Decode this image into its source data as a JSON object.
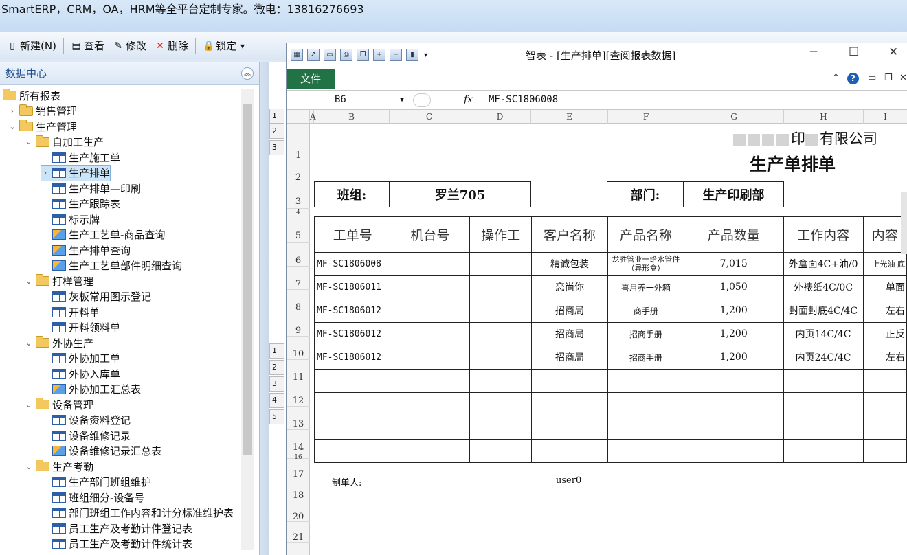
{
  "banner": {
    "text": "SmartERP，CRM，OA，HRM等全平台定制专家。微电：13816276693"
  },
  "toolbar": [
    {
      "id": "new",
      "label": "新建(N)",
      "icon": "new-doc-icon",
      "glyph": "▯"
    },
    {
      "id": "view",
      "label": "查看",
      "icon": "view-icon",
      "glyph": "▤"
    },
    {
      "id": "edit",
      "label": "修改",
      "icon": "edit-icon",
      "glyph": "✎"
    },
    {
      "id": "delete",
      "label": "删除",
      "icon": "delete-icon",
      "glyph": "✕"
    },
    {
      "id": "lock",
      "label": "锁定",
      "icon": "lock-icon",
      "glyph": "🔒"
    }
  ],
  "sidebar": {
    "title": "数据中心",
    "items": [
      {
        "label": "所有报表",
        "level": 0,
        "type": "folder",
        "arrow": ""
      },
      {
        "label": "销售管理",
        "level": 1,
        "type": "folder",
        "arrow": "›"
      },
      {
        "label": "生产管理",
        "level": 1,
        "type": "folder",
        "arrow": "⌄"
      },
      {
        "label": "自加工生产",
        "level": 2,
        "type": "folder",
        "arrow": "⌄"
      },
      {
        "label": "生产施工单",
        "level": 3,
        "type": "grid",
        "arrow": ""
      },
      {
        "label": "生产排单",
        "level": 3,
        "type": "grid",
        "arrow": "›",
        "selected": true
      },
      {
        "label": "生产排单—印刷",
        "level": 3,
        "type": "grid",
        "arrow": ""
      },
      {
        "label": "生产跟踪表",
        "level": 3,
        "type": "grid",
        "arrow": ""
      },
      {
        "label": "标示牌",
        "level": 3,
        "type": "grid",
        "arrow": ""
      },
      {
        "label": "生产工艺单-商品查询",
        "level": 3,
        "type": "chart",
        "arrow": ""
      },
      {
        "label": "生产排单查询",
        "level": 3,
        "type": "chart",
        "arrow": ""
      },
      {
        "label": "生产工艺单部件明细查询",
        "level": 3,
        "type": "chart",
        "arrow": ""
      },
      {
        "label": "打样管理",
        "level": 2,
        "type": "folder",
        "arrow": "⌄"
      },
      {
        "label": "灰板常用图示登记",
        "level": 3,
        "type": "grid",
        "arrow": ""
      },
      {
        "label": "开料单",
        "level": 3,
        "type": "grid",
        "arrow": ""
      },
      {
        "label": "开料领料单",
        "level": 3,
        "type": "grid",
        "arrow": ""
      },
      {
        "label": "外协生产",
        "level": 2,
        "type": "folder",
        "arrow": "⌄"
      },
      {
        "label": "外协加工单",
        "level": 3,
        "type": "grid",
        "arrow": ""
      },
      {
        "label": "外协入库单",
        "level": 3,
        "type": "grid",
        "arrow": ""
      },
      {
        "label": "外协加工汇总表",
        "level": 3,
        "type": "chart",
        "arrow": ""
      },
      {
        "label": "设备管理",
        "level": 2,
        "type": "folder",
        "arrow": "⌄"
      },
      {
        "label": "设备资料登记",
        "level": 3,
        "type": "grid",
        "arrow": ""
      },
      {
        "label": "设备维修记录",
        "level": 3,
        "type": "grid",
        "arrow": ""
      },
      {
        "label": "设备维修记录汇总表",
        "level": 3,
        "type": "chart",
        "arrow": ""
      },
      {
        "label": "生产考勤",
        "level": 2,
        "type": "folder",
        "arrow": "⌄"
      },
      {
        "label": "生产部门班组维护",
        "level": 3,
        "type": "grid",
        "arrow": ""
      },
      {
        "label": "班组细分-设备号",
        "level": 3,
        "type": "grid",
        "arrow": ""
      },
      {
        "label": "部门班组工作内容和计分标准维护表",
        "level": 3,
        "type": "grid",
        "arrow": ""
      },
      {
        "label": "员工生产及考勤计件登记表",
        "level": 3,
        "type": "grid",
        "arrow": ""
      },
      {
        "label": "员工生产及考勤计件统计表",
        "level": 3,
        "type": "grid",
        "arrow": ""
      }
    ]
  },
  "window": {
    "title": "智表 - [生产排单][查阅报表数据]",
    "file_tab": "文件",
    "name_box": "B6",
    "fx": "fx",
    "formula_value": "MF-SC1806008"
  },
  "sheet": {
    "columns": [
      "A",
      "B",
      "C",
      "D",
      "E",
      "F",
      "G",
      "H",
      "I"
    ],
    "rows": [
      "1",
      "2",
      "3",
      "4",
      "5",
      "6",
      "7",
      "8",
      "9",
      "10",
      "11",
      "12",
      "13",
      "14",
      "16",
      "17",
      "18",
      "20",
      "21"
    ],
    "company_visible": "印",
    "company_suffix": "有限公司",
    "title": "生产单排单",
    "team_label": "班组:",
    "team_value": "罗兰705",
    "dept_label": "部门:",
    "dept_value": "生产印刷部",
    "headers": [
      "工单号",
      "机台号",
      "操作工",
      "客户名称",
      "产品名称",
      "产品数量",
      "工作内容",
      "内容"
    ],
    "data_rows": [
      [
        "MF-SC1806008",
        "",
        "",
        "精诚包装",
        "龙胜管业一给水管件（异形盒）",
        "7,015",
        "外盒面4C+油/0",
        "上光油 底"
      ],
      [
        "MF-SC1806011",
        "",
        "",
        "恋尚你",
        "喜月养一外箱",
        "1,050",
        "外裱纸4C/0C",
        "单面"
      ],
      [
        "MF-SC1806012",
        "",
        "",
        "招商局",
        "商手册",
        "1,200",
        "封面封底4C/4C",
        "左右"
      ],
      [
        "MF-SC1806012",
        "",
        "",
        "招商局",
        "招商手册",
        "1,200",
        "内页14C/4C",
        "正反"
      ],
      [
        "MF-SC1806012",
        "",
        "",
        "招商局",
        "招商手册",
        "1,200",
        "内页24C/4C",
        "左右"
      ]
    ],
    "empty_rows": 4,
    "creator_label": "制单人:",
    "creator_value": "user0"
  },
  "mini_rows": [
    "1",
    "2",
    "3",
    "1",
    "2",
    "3",
    "4",
    "5"
  ]
}
